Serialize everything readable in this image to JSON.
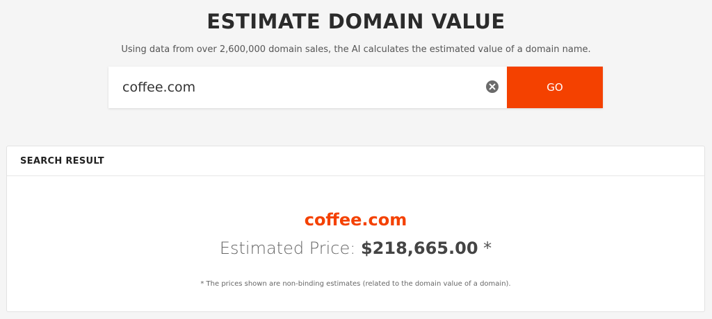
{
  "header": {
    "title": "ESTIMATE DOMAIN VALUE",
    "subtitle": "Using data from over 2,600,000 domain sales, the AI calculates the estimated value of a domain name."
  },
  "search": {
    "value": "coffee.com",
    "clear_icon": "clear-circle-x-icon",
    "go_label": "GO"
  },
  "result": {
    "section_title": "SEARCH RESULT",
    "domain": "coffee.com",
    "price_label": "Estimated Price:",
    "price_value": "$218,665.00",
    "price_asterisk": "*",
    "note": "* The prices shown are non-binding estimates (related to the domain value of a domain)."
  },
  "colors": {
    "accent": "#f44100",
    "background": "#f5f5f5",
    "card": "#ffffff"
  }
}
